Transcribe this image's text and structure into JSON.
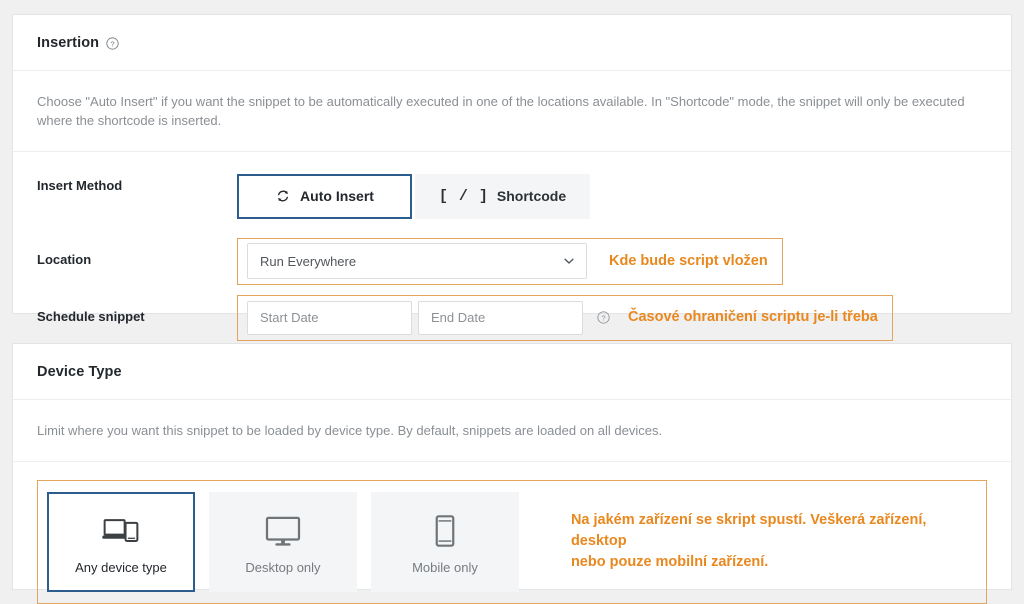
{
  "theme": {
    "page_bg": "#f0f0f1",
    "card_bg": "#ffffff",
    "accent_orange": "#e8881f",
    "annot_border": "#e5a45c",
    "selected_blue": "#2c5d8f",
    "muted_text": "#8a8f94"
  },
  "insertion": {
    "title": "Insertion",
    "help_icon": "help-circle-icon",
    "description": "Choose \"Auto Insert\" if you want the snippet to be automatically executed in one of the locations available. In \"Shortcode\" mode, the snippet will only be executed where the shortcode is inserted.",
    "insert_method": {
      "label": "Insert Method",
      "options": [
        {
          "label": "Auto Insert",
          "icon": "sync-refresh-icon",
          "selected": true
        },
        {
          "label": "Shortcode",
          "icon": "square-brackets-slash-icon",
          "glyph": "[ / ]",
          "selected": false
        }
      ]
    },
    "location": {
      "label": "Location",
      "selected_value": "Run Everywhere",
      "dropdown_icon": "chevron-down-icon",
      "annotation": "Kde bude script vložen"
    },
    "schedule": {
      "label": "Schedule snippet",
      "start_date_placeholder": "Start Date",
      "end_date_placeholder": "End Date",
      "help_icon": "help-circle-icon",
      "annotation": "Časové ohraničení scriptu je-li třeba"
    }
  },
  "device_type": {
    "title": "Device Type",
    "description": "Limit where you want this snippet to be loaded by device type. By default, snippets are loaded on all devices.",
    "options": [
      {
        "label": "Any device type",
        "icon": "laptop-and-phone-icon",
        "selected": true
      },
      {
        "label": "Desktop only",
        "icon": "desktop-monitor-icon",
        "selected": false
      },
      {
        "label": "Mobile only",
        "icon": "mobile-phone-icon",
        "selected": false
      }
    ],
    "annotation_line1": "Na jakém zařízení se skript spustí. Veškerá zařízení, desktop",
    "annotation_line2": "nebo pouze mobilní zařízení."
  }
}
